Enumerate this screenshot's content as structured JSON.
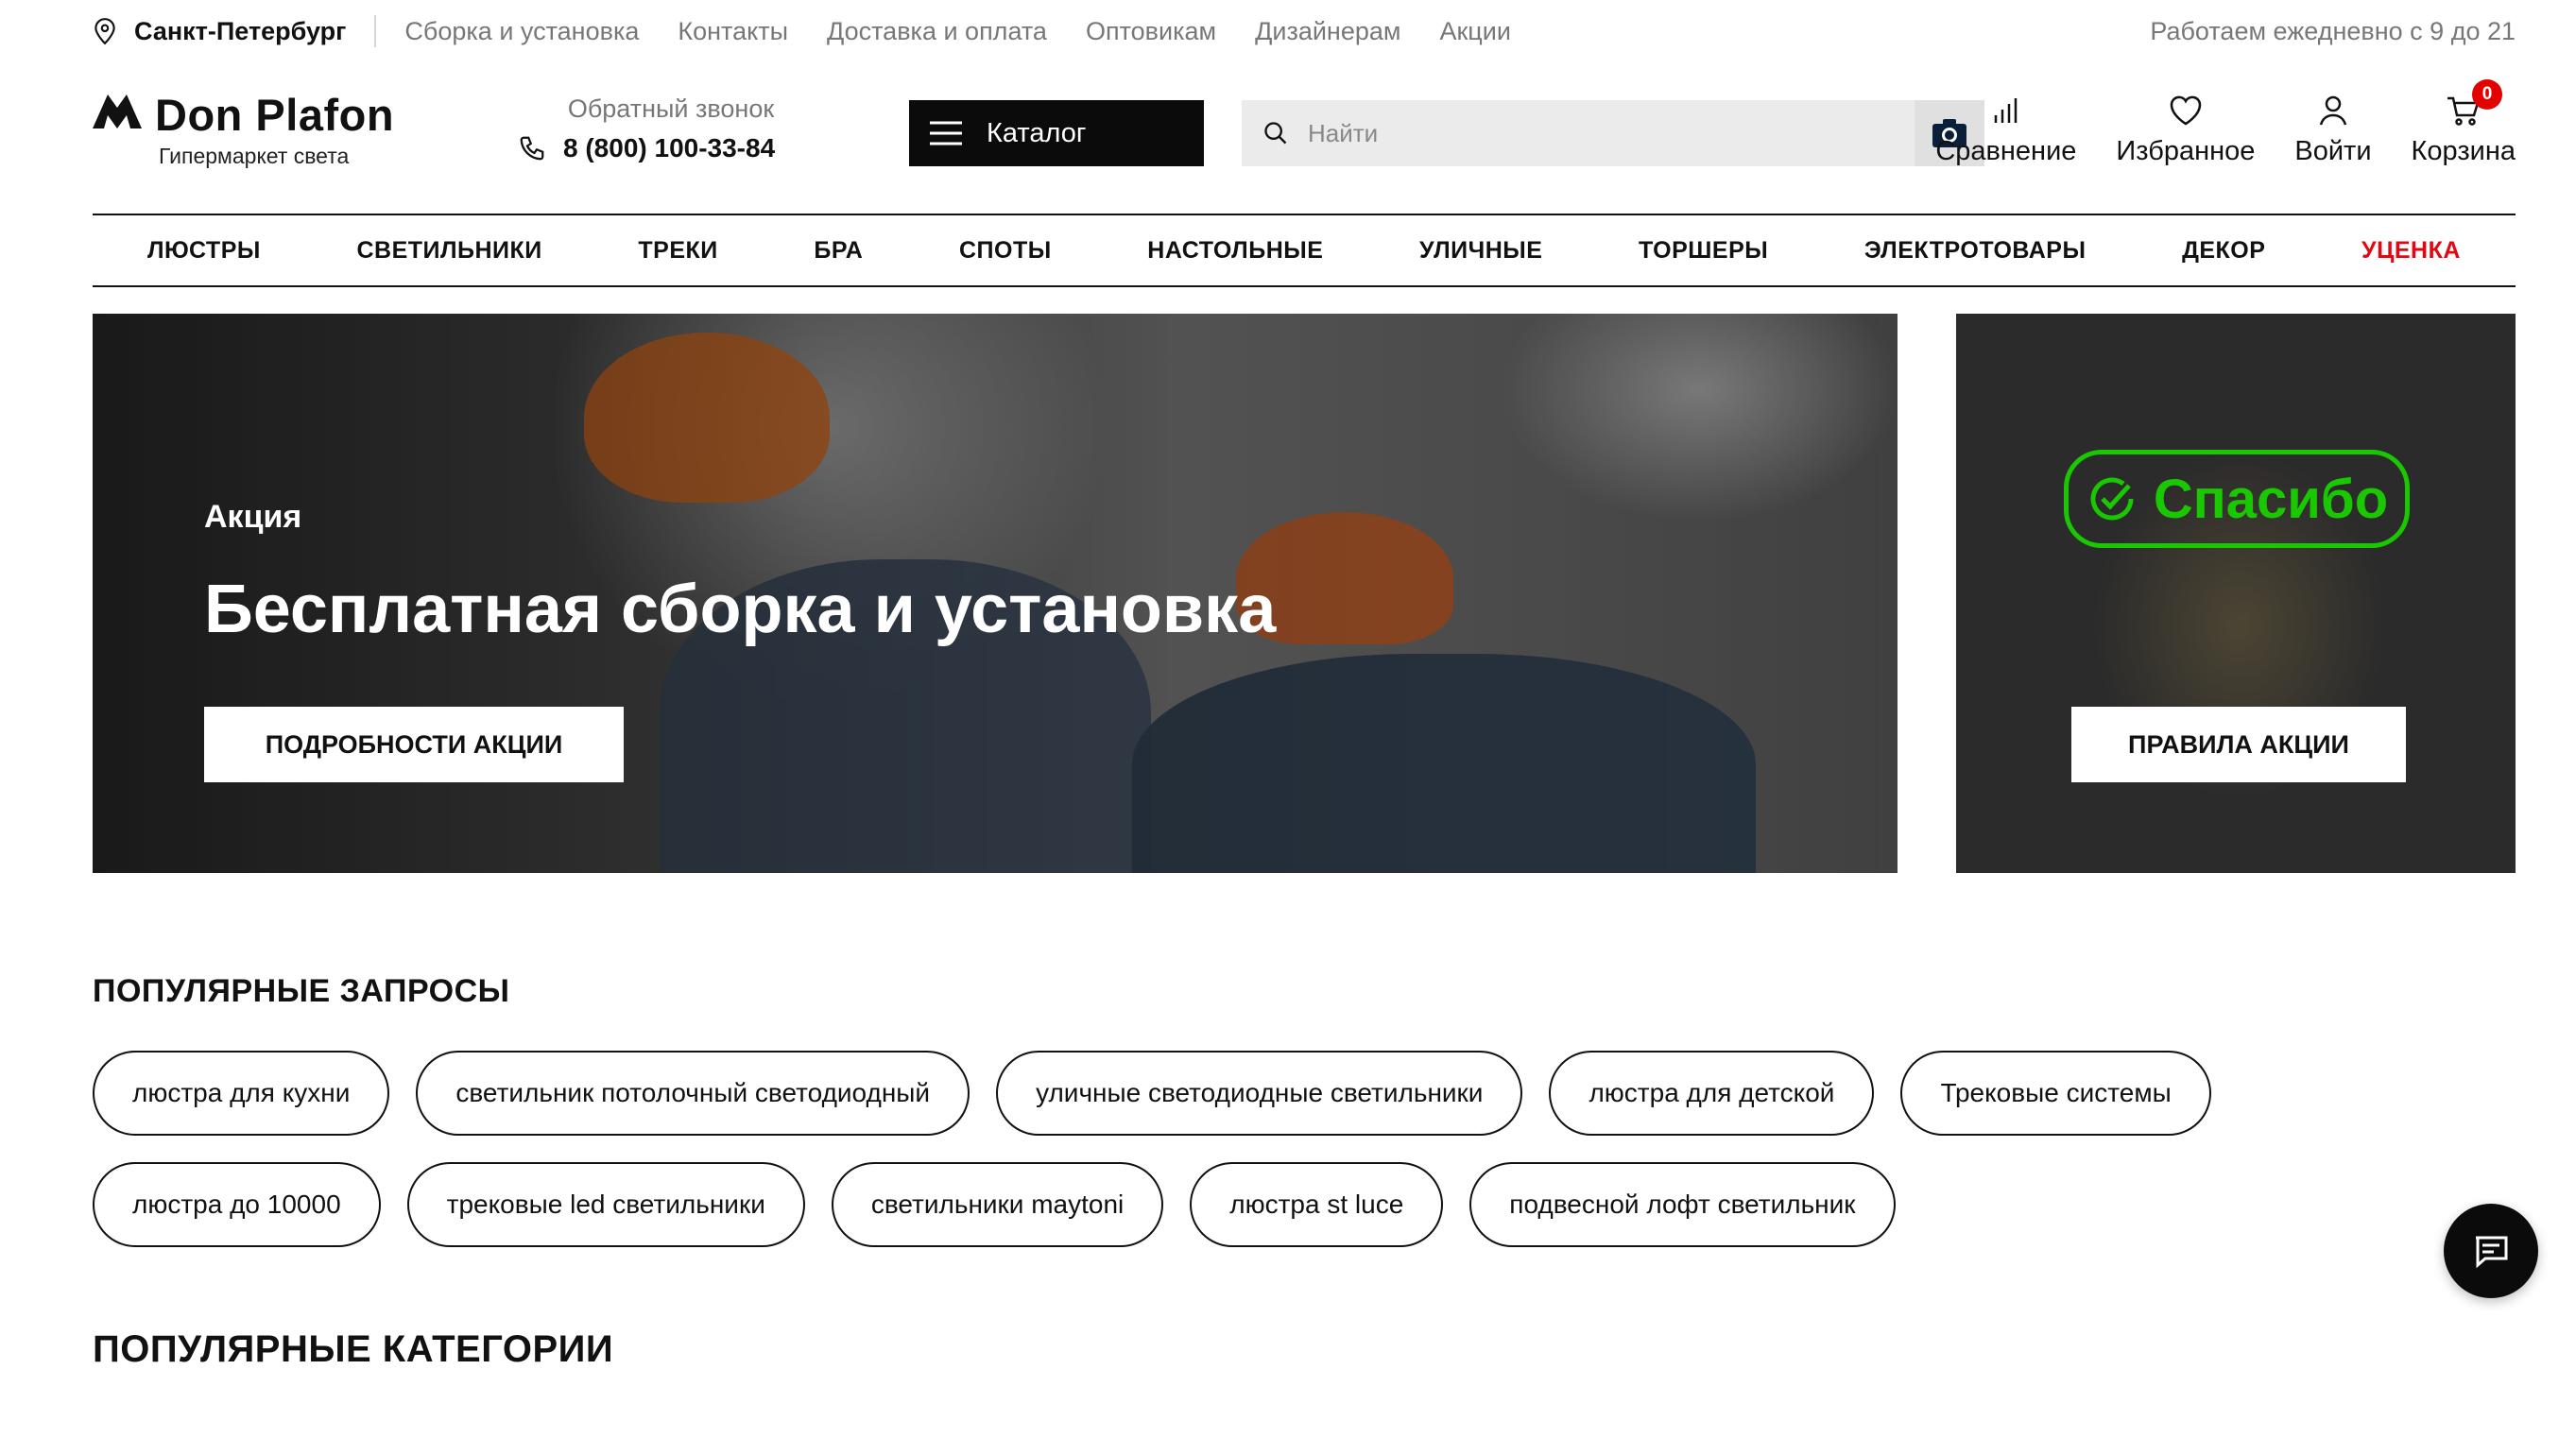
{
  "topbar": {
    "city": "Санкт-Петербург",
    "links": [
      "Сборка и установка",
      "Контакты",
      "Доставка и оплата",
      "Оптовикам",
      "Дизайнерам",
      "Акции"
    ],
    "hours": "Работаем ежедневно с 9 до 21"
  },
  "header": {
    "logo_name": "Don Plafon",
    "logo_tagline": "Гипермаркет света",
    "callback_label": "Обратный звонок",
    "phone": "8 (800) 100-33-84",
    "catalog_label": "Каталог",
    "search_placeholder": "Найти",
    "compare_label": "Сравнение",
    "favorites_label": "Избранное",
    "login_label": "Войти",
    "cart_label": "Корзина",
    "cart_count": "0"
  },
  "nav": {
    "items": [
      "ЛЮСТРЫ",
      "СВЕТИЛЬНИКИ",
      "ТРЕКИ",
      "БРА",
      "СПОТЫ",
      "НАСТОЛЬНЫЕ",
      "УЛИЧНЫЕ",
      "ТОРШЕРЫ",
      "ЭЛЕКТРОТОВАРЫ",
      "ДЕКОР"
    ],
    "sale_label": "УЦЕНКА",
    "sale_color": "#e30613"
  },
  "hero": {
    "kicker": "Акция",
    "title": "Бесплатная сборка и установка",
    "button_label": "ПОДРОБНОСТИ АКЦИИ"
  },
  "promo": {
    "badge_text": "Спасибо",
    "badge_color": "#19c800",
    "button_label": "ПРАВИЛА АКЦИИ"
  },
  "popular_queries": {
    "title": "ПОПУЛЯРНЫЕ ЗАПРОСЫ",
    "row1": [
      "люстра для кухни",
      "светильник потолочный светодиодный",
      "уличные светодиодные светильники",
      "люстра для детской",
      "Трековые системы"
    ],
    "row2": [
      "люстра до 10000",
      "трековые led светильники",
      "светильники maytoni",
      "люстра st luce",
      "подвесной лофт светильник"
    ]
  },
  "popular_categories": {
    "title": "ПОПУЛЯРНЫЕ КАТЕГОРИИ"
  },
  "icons": {
    "location": "map-pin-icon",
    "phone": "phone-icon",
    "menu": "hamburger-icon",
    "search": "search-icon",
    "camera": "camera-icon",
    "compare": "bar-chart-icon",
    "favorites": "heart-icon",
    "login": "user-icon",
    "cart": "cart-icon",
    "chat": "chat-icon"
  }
}
